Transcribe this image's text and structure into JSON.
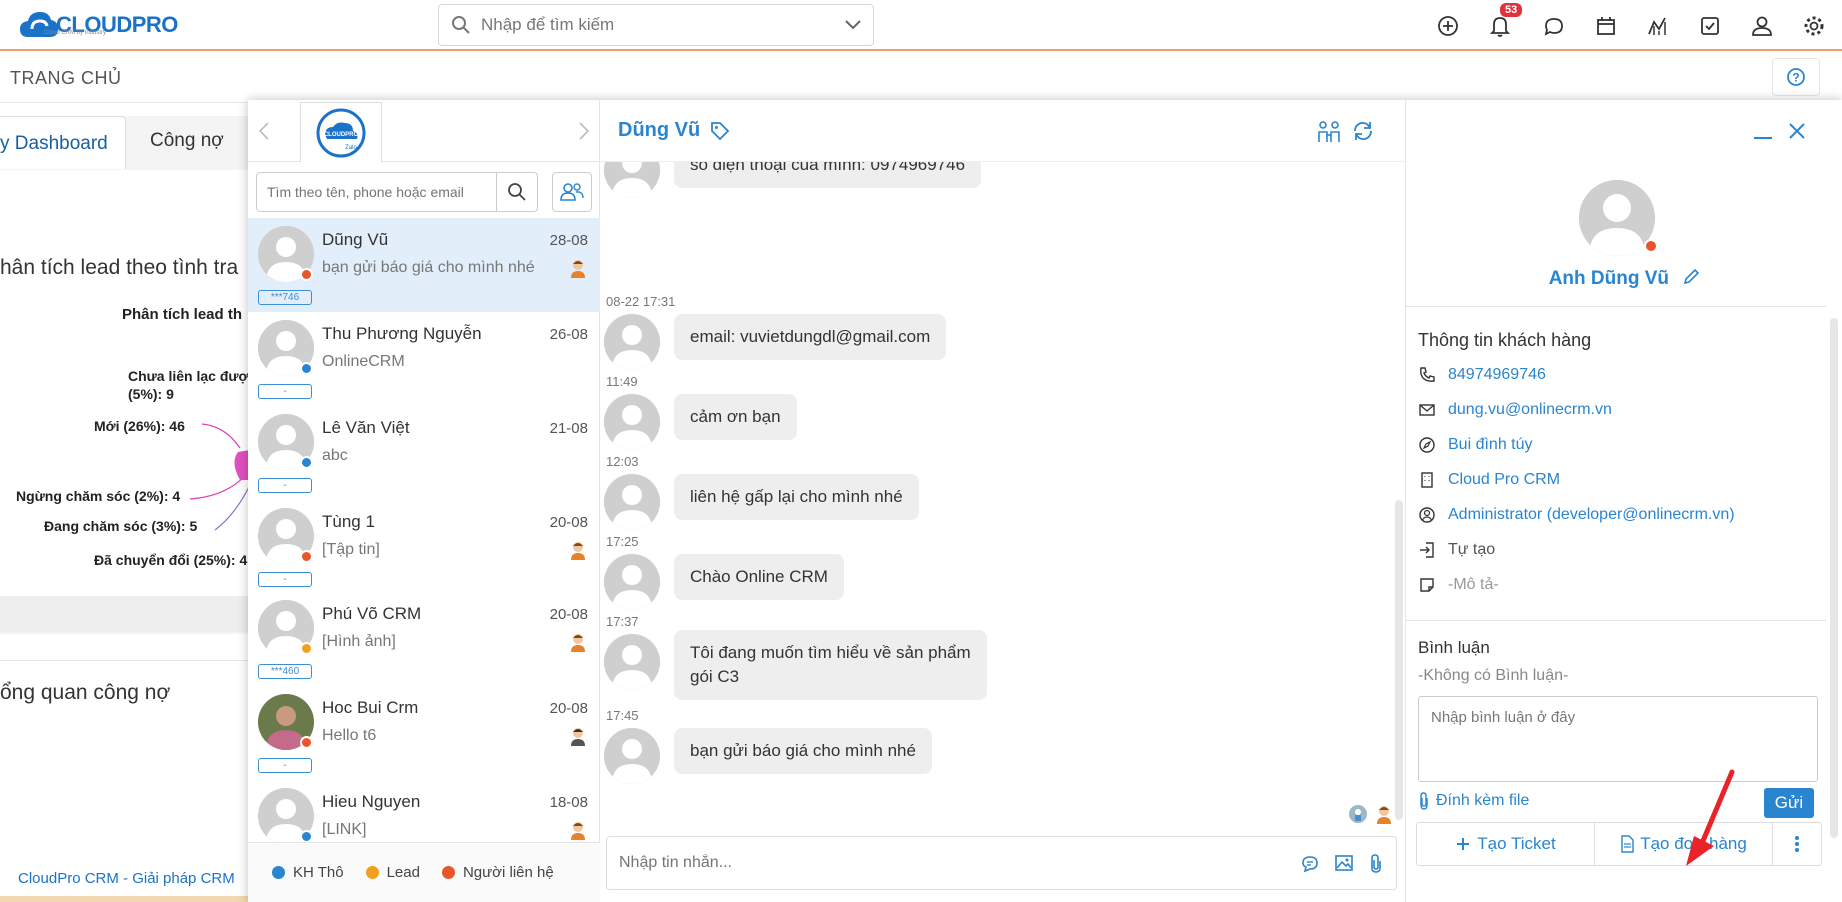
{
  "topbar": {
    "logo_text": "CLOUDPRO",
    "logo_tagline": "Cloud CRM by Industry",
    "search_placeholder": "Nhập để tìm kiếm",
    "notifications_count": "53"
  },
  "breadcrumb": "TRANG CHỦ",
  "dashboard": {
    "tabs": [
      "y Dashboard",
      "Công nợ"
    ],
    "card1_title": "hân tích lead theo tình tra",
    "pie_title": "Phân tích lead th",
    "pie_labels": [
      "Chưa liên lạc đượ",
      "(5%): 9",
      "Mới (26%): 46",
      "Ngừng chăm sóc (2%): 4",
      "Đang chăm sóc (3%): 5",
      "Đã chuyển đổi (25%): 4"
    ],
    "card2_title": "ổng quan công nợ",
    "footer_link": "CloudPro CRM - Giải pháp CRM"
  },
  "chat_list": {
    "search_placeholder": "Tìm theo tên, phone hoặc email",
    "conversations": [
      {
        "name": "Dũng Vũ",
        "date": "28-08",
        "preview": "bạn gửi báo giá cho mình nhé",
        "phone": "***746",
        "status_color": "#e8552a",
        "active": true
      },
      {
        "name": "Thu Phương Nguyễn",
        "date": "26-08",
        "preview": "OnlineCRM",
        "phone": "-",
        "status_color": "#2a85d0"
      },
      {
        "name": "Lê Văn Việt",
        "date": "21-08",
        "preview": "abc",
        "phone": "-",
        "status_color": "#2a85d0"
      },
      {
        "name": "Tùng 1",
        "date": "20-08",
        "preview": "[Tập tin]",
        "phone": "-",
        "status_color": "#e8552a"
      },
      {
        "name": "Phú Võ CRM",
        "date": "20-08",
        "preview": "[Hình ảnh]",
        "phone": "***460",
        "status_color": "#f0a020"
      },
      {
        "name": "Hoc Bui Crm",
        "date": "20-08",
        "preview": "Hello t6",
        "phone": "-",
        "status_color": "#e8552a"
      },
      {
        "name": "Hieu Nguyen",
        "date": "18-08",
        "preview": "[LINK]",
        "phone": "",
        "status_color": "#2a85d0"
      }
    ],
    "legend": [
      {
        "label": "KH Thô",
        "color": "#2a85d0"
      },
      {
        "label": "Lead",
        "color": "#f0a020"
      },
      {
        "label": "Người liên hệ",
        "color": "#e8552a"
      }
    ]
  },
  "chat": {
    "contact_name": "Dũng Vũ",
    "messages": [
      {
        "time": "",
        "text": "số điện thoại của mình: 0974969746"
      },
      {
        "time": "08-22 17:31",
        "text": "email: vuvietdungdl@gmail.com"
      },
      {
        "time": "11:49",
        "text": "cảm ơn bạn"
      },
      {
        "time": "12:03",
        "text": "liên hệ gấp lại cho mình nhé"
      },
      {
        "time": "17:25",
        "text": "Chào Online CRM"
      },
      {
        "time": "17:37",
        "text": "Tôi đang muốn tìm hiểu về sản phẩm",
        "text2": "gói C3"
      },
      {
        "time": "17:45",
        "text": "bạn gửi báo giá cho mình nhé"
      }
    ],
    "compose_placeholder": "Nhập tin nhắn..."
  },
  "info": {
    "profile_name": "Anh Dũng Vũ",
    "section_title": "Thông tin khách hàng",
    "phone": "84974969746",
    "email": "dung.vu@onlinecrm.vn",
    "address": "Bui đình túy",
    "company": "Cloud Pro CRM",
    "owner": "Administrator (developer@onlinecrm.vn)",
    "source": "Tự tạo",
    "description": "-Mô tả-",
    "comment_title": "Bình luận",
    "no_comment": "-Không có Bình luận-",
    "comment_placeholder": "Nhập bình luận ở đây",
    "attach_label": "Đính kèm file",
    "send_label": "Gửi",
    "create_ticket": "Tạo Ticket",
    "create_order": "Tạo đơn hàng"
  },
  "colors": {
    "accent": "#2a85d0",
    "arrow": "#e8232a"
  }
}
